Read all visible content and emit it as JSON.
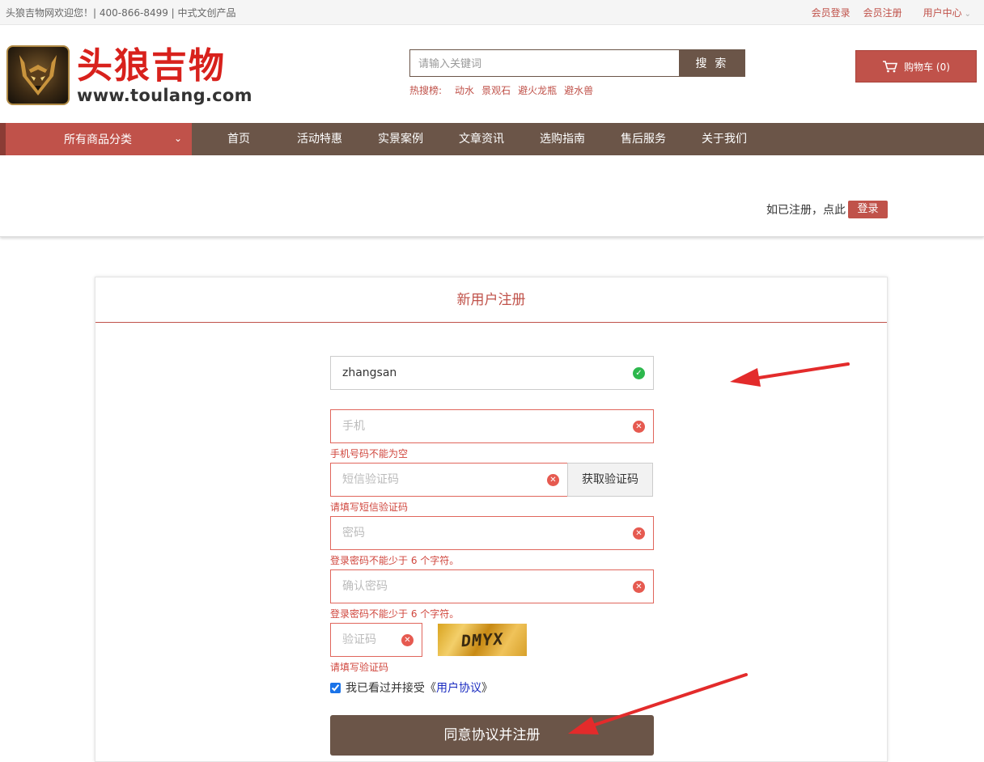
{
  "topbar": {
    "welcome": "头狼吉物网欢迎您！| 400-866-8499 | 中式文创产品",
    "login": "会员登录",
    "register": "会员注册",
    "user_center": "用户中心"
  },
  "logo": {
    "cn": "头狼吉物",
    "en": "www.toulang.com"
  },
  "search": {
    "placeholder": "请输入关键词",
    "button": "搜 索",
    "hot_label": "热搜榜:",
    "hot_items": [
      "动水",
      "景观石",
      "避火龙瓶",
      "避水兽"
    ]
  },
  "cart": {
    "label": "购物车 (0)"
  },
  "nav": {
    "all_categories": "所有商品分类",
    "items": [
      "首页",
      "活动特惠",
      "实景案例",
      "文章资讯",
      "选购指南",
      "售后服务",
      "关于我们"
    ]
  },
  "loginbar": {
    "text": "如已注册，点此",
    "button": "登录"
  },
  "form": {
    "title": "新用户注册",
    "username_value": "zhangsan",
    "phone_placeholder": "手机",
    "phone_error": "手机号码不能为空",
    "sms_placeholder": "短信验证码",
    "sms_button": "获取验证码",
    "sms_error": "请填写短信验证码",
    "password_placeholder": "密码",
    "password_error": "登录密码不能少于 6 个字符。",
    "confirm_placeholder": "确认密码",
    "confirm_error": "登录密码不能少于 6 个字符。",
    "captcha_placeholder": "验证码",
    "captcha_text": "DMYX",
    "captcha_error": "请填写验证码",
    "agree_prefix": "我已看过并接受《",
    "agree_link": "用户协议",
    "agree_suffix": "》",
    "agree_checked": true,
    "submit": "同意协议并注册"
  },
  "colors": {
    "brand_red": "#c0524a",
    "brand_brown": "#6b5548",
    "annotation_red": "#e32b2b"
  }
}
